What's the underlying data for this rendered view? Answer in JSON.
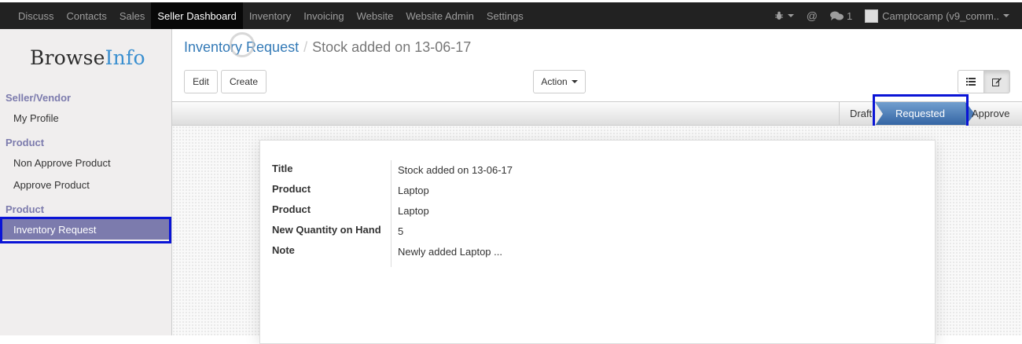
{
  "topbar": {
    "menu": [
      "Discuss",
      "Contacts",
      "Sales",
      "Seller Dashboard",
      "Inventory",
      "Invoicing",
      "Website",
      "Website Admin",
      "Settings"
    ],
    "active_menu": "Seller Dashboard",
    "messages_count": "1",
    "company": "Camptocamp (v9_comm.."
  },
  "sidebar": {
    "logo_browse": "Browse",
    "logo_info": "Info",
    "sections": [
      {
        "title": "Seller/Vendor",
        "items": [
          "My Profile"
        ]
      },
      {
        "title": "Product",
        "items": [
          "Non Approve Product",
          "Approve Product"
        ]
      },
      {
        "title": "Product",
        "items": [
          "Inventory Request"
        ]
      }
    ]
  },
  "breadcrumb": {
    "parent": "Inventory Request",
    "separator": "/",
    "current": "Stock added on 13-06-17"
  },
  "buttons": {
    "edit": "Edit",
    "create": "Create",
    "action": "Action"
  },
  "status": {
    "stages": [
      "Draft",
      "Requested",
      "Approve"
    ],
    "current": "Requested"
  },
  "form": {
    "fields": [
      {
        "label": "Title",
        "value": "Stock added on 13-06-17"
      },
      {
        "label": "Product",
        "value": "Laptop"
      },
      {
        "label": "Product",
        "value": "Laptop"
      },
      {
        "label": "New Quantity on Hand",
        "value": "5"
      },
      {
        "label": "Note",
        "value": "Newly added Laptop ..."
      }
    ]
  },
  "colors": {
    "topbar_bg": "#222222",
    "sidebar_accent": "#7c7bad",
    "status_active": "#3465a4",
    "highlight_box": "#0a14d6"
  }
}
